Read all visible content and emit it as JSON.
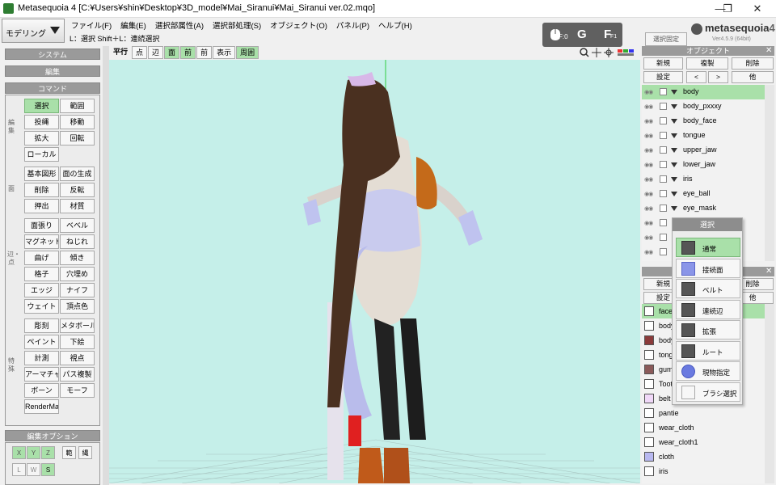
{
  "window": {
    "title": "Metasequoia 4 [C:¥Users¥shin¥Desktop¥3D_model¥Mai_Siranui¥Mai_Siranui ver.02.mqo]",
    "minimize": "—",
    "maximize": "❐",
    "close": "✕"
  },
  "mode": {
    "label": "モデリング"
  },
  "menu": [
    "ファイル(F)",
    "編集(E)",
    "選択部属性(A)",
    "選択部処理(S)",
    "オブジェクト(O)",
    "パネル(P)",
    "ヘルプ(H)"
  ],
  "status_text": "L：選択  Shift＋L：連続選択",
  "key_overlay": {
    "k1": "F:0",
    "k2": "G",
    "k3": "F",
    "k4": "F1"
  },
  "select_fix": "選択固定",
  "logo": {
    "text": "metasequoia",
    "digit": "4",
    "version": "Ver4.5.9 (64bit)"
  },
  "left_panel": {
    "system": "システム",
    "edit": "編集",
    "command": "コマンド",
    "groups": {
      "edit": "編集",
      "face": "面",
      "edge": "辺・点",
      "special": "特殊"
    },
    "buttons": [
      "選択",
      "範囲",
      "投縄",
      "移動",
      "拡大",
      "回転",
      "ローカル",
      "基本図形",
      "面の生成",
      "削除",
      "反転",
      "押出",
      "材質",
      "面張り",
      "ベベル",
      "マグネット",
      "ねじれ",
      "曲げ",
      "傾き",
      "格子",
      "穴埋め",
      "エッジ",
      "ナイフ",
      "ウェイト",
      "頂点色",
      "彫刻",
      "メタボール",
      "ペイント",
      "下絵",
      "計測",
      "視点",
      "アーマチャー",
      "パス複製",
      "ボーン",
      "モーフ",
      "RenderMan"
    ],
    "edit_options": "編集オプション",
    "opt_xyz": [
      "X",
      "Y",
      "Z"
    ],
    "opt_range": "範",
    "opt_lasso": "縄",
    "opt_lws": [
      "L",
      "W",
      "S"
    ]
  },
  "view_toolbar": [
    "平行",
    "点",
    "辺",
    "面",
    "前",
    "前",
    "表示",
    "周囲"
  ],
  "object_panel": {
    "title": "オブジェクト",
    "buttons": [
      "新規",
      "複製",
      "削除",
      "設定",
      "<",
      ">",
      "他"
    ],
    "objects": [
      "body",
      "body_pxxxy",
      "body_face",
      "tongue",
      "upper_jaw",
      "lower_jaw",
      "iris",
      "eye_ball",
      "eye_mask",
      "",
      "",
      ""
    ]
  },
  "material_panel": {
    "buttons": [
      "新規",
      "削除",
      "設定",
      "他"
    ],
    "materials": [
      {
        "name": "face",
        "color": "#ffffff"
      },
      {
        "name": "body",
        "color": "#ffffff"
      },
      {
        "name": "body",
        "color": "#8b3a3a"
      },
      {
        "name": "tongue",
        "color": "#ffffff"
      },
      {
        "name": "gum",
        "color": "#8b5a5a"
      },
      {
        "name": "Tooth",
        "color": "#ffffff"
      },
      {
        "name": "belt",
        "color": "#f0d8f8"
      },
      {
        "name": "pantie",
        "color": "#ffffff"
      },
      {
        "name": "wear_cloth",
        "color": "#ffffff"
      },
      {
        "name": "wear_cloth1",
        "color": "#ffffff"
      },
      {
        "name": "cloth",
        "color": "#b8b8f0"
      },
      {
        "name": "iris",
        "color": "#ffffff"
      }
    ]
  },
  "select_popup": {
    "title": "選択",
    "items": [
      "通常",
      "接続面",
      "ベルト",
      "連続辺",
      "拡張",
      "ルート",
      "現物指定",
      "ブラシ選択"
    ]
  },
  "colors": {
    "accent": "#a9e0a9",
    "viewport_bg": "#c5efe9",
    "header": "#9a9a9a"
  }
}
